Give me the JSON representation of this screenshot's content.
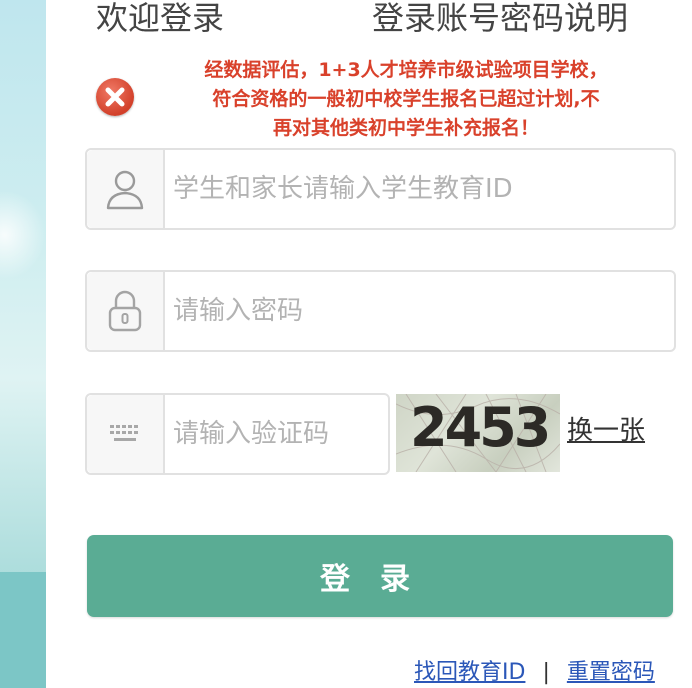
{
  "tabs": {
    "login": "欢迎登录",
    "help": "登录账号密码说明"
  },
  "notice": {
    "icon": "error-icon",
    "color": "#d9412b",
    "lines": [
      "经数据评估，1+3人才培养市级试验项目学校，",
      "符合资格的一般初中校学生报名已超过计划,不",
      "再对其他类初中学生补充报名！"
    ]
  },
  "form": {
    "user_placeholder": "学生和家长请输入学生教育ID",
    "password_placeholder": "请输入密码",
    "captcha_placeholder": "请输入验证码",
    "captcha_code": "2453",
    "refresh_label": "换一张",
    "login_label": "登录"
  },
  "links": {
    "find_id": "找回教育ID",
    "separator": "|",
    "reset_password": "重置密码"
  },
  "colors": {
    "accent": "#5aac94",
    "link": "#2b57b8"
  }
}
